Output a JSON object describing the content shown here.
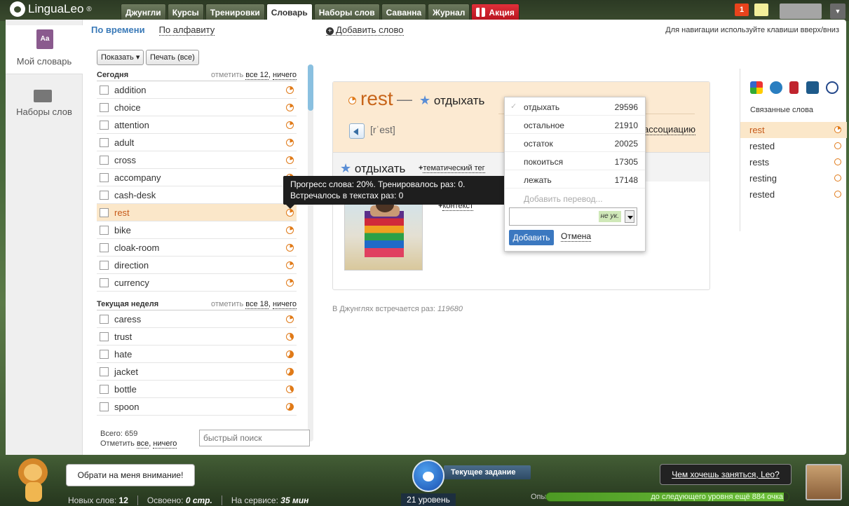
{
  "topbar": {
    "logo_text": "LinguaLeo",
    "logo_mark": "®",
    "tabs": [
      "Джунгли",
      "Курсы",
      "Тренировки",
      "Словарь",
      "Наборы слов",
      "Саванна",
      "Журнал"
    ],
    "promo_tab": "Акция",
    "notif_count": "1",
    "user_menu_icon": "▼"
  },
  "sidebar": {
    "items": [
      {
        "label": "Мой словарь",
        "icon": "dictionary-icon",
        "icon_text": "Aa"
      },
      {
        "label": "Наборы слов",
        "icon": "word-sets-icon"
      }
    ]
  },
  "subtabs": {
    "tabs": [
      "По времени",
      "По алфавиту"
    ],
    "add_word": "Добавить слово",
    "plus": "+",
    "hint": "Для навигации используйте клавиши вверх/вниз"
  },
  "toolbar": {
    "show": "Показать",
    "show_arrow": "▾",
    "print": "Печать (все)"
  },
  "groups": [
    {
      "title": "Сегодня",
      "mark_label": "отметить",
      "mark_all": "все 12",
      "comma": ",",
      "mark_none": "ничего",
      "words": [
        {
          "w": "addition",
          "p": 20
        },
        {
          "w": "choice",
          "p": 20
        },
        {
          "w": "attention",
          "p": 20
        },
        {
          "w": "adult",
          "p": 20
        },
        {
          "w": "cross",
          "p": 20
        },
        {
          "w": "accompany",
          "p": 20
        },
        {
          "w": "cash-desk",
          "p": 20
        },
        {
          "w": "rest",
          "p": 20
        },
        {
          "w": "bike",
          "p": 20
        },
        {
          "w": "cloak-room",
          "p": 20
        },
        {
          "w": "direction",
          "p": 20
        },
        {
          "w": "currency",
          "p": 20
        }
      ]
    },
    {
      "title": "Текущая неделя",
      "mark_label": "отметить",
      "mark_all": "все 18",
      "comma": ",",
      "mark_none": "ничего",
      "words": [
        {
          "w": "caress",
          "p": 20
        },
        {
          "w": "trust",
          "p": 40
        },
        {
          "w": "hate",
          "p": 60
        },
        {
          "w": "jacket",
          "p": 60
        },
        {
          "w": "bottle",
          "p": 40
        },
        {
          "w": "spoon",
          "p": 60
        }
      ]
    }
  ],
  "totals": {
    "total": "Всего: 659",
    "mark_label": "Отметить",
    "all": "все",
    "comma": ",",
    "none": "ничего",
    "search_placeholder": "быстрый поиск"
  },
  "card": {
    "word": "rest",
    "dash": "—",
    "translation": "отдыхать",
    "transcription": "[rˈest]",
    "association": "ассоциацию",
    "section_translation": "отдыхать",
    "plus": "+",
    "thematic_tag": "тематический тег",
    "context": "контекст",
    "occurrence_label": "В Джунглях встречается раз:",
    "occurrence_count": "119680"
  },
  "tooltip": {
    "line1": "Прогресс слова: 20%. Тренировалось раз: 0.",
    "line2": "Встречалось в текстах раз: 0"
  },
  "translations": {
    "items": [
      {
        "word": "отдыхать",
        "count": "29596",
        "checked": true
      },
      {
        "word": "остальное",
        "count": "21910"
      },
      {
        "word": "остаток",
        "count": "20025"
      },
      {
        "word": "покоиться",
        "count": "17305"
      },
      {
        "word": "лежать",
        "count": "17148"
      }
    ],
    "check_mark": "✓",
    "add_placeholder": "Добавить перевод...",
    "lang_label": "не ук.",
    "add_button": "Добавить",
    "cancel": "Отмена"
  },
  "related": {
    "title": "Связанные слова",
    "external_icons": [
      "google-icon",
      "wordpress-icon",
      "book-icon",
      "multitran-icon",
      "abbyy-icon"
    ],
    "items": [
      {
        "w": "rest",
        "p": 20
      },
      {
        "w": "rested",
        "p": 0
      },
      {
        "w": "rests",
        "p": 0
      },
      {
        "w": "resting",
        "p": 0
      },
      {
        "w": "rested",
        "p": 0
      }
    ]
  },
  "footer": {
    "leo_prompt": "Обрати на меня внимание!",
    "new_words_label": "Новых слов:",
    "new_words": "12",
    "learned_label": "Освоено:",
    "learned": "0 стр.",
    "service_label": "На сервисе:",
    "service": "35 мин",
    "task_label": "Текущее задание",
    "level": "21 уровень",
    "exp_label": "Опыт",
    "exp_text": "до следующего уровня ещё 884 очка",
    "exp_progress": 0.98,
    "leo_question": "Чем хочешь заняться, Leo?"
  }
}
